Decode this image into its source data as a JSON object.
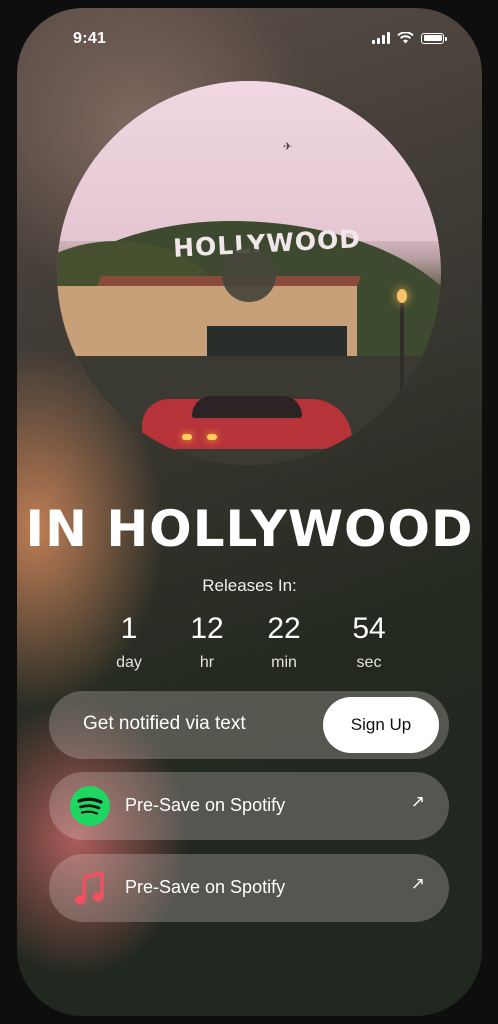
{
  "status_bar": {
    "time": "9:41"
  },
  "album": {
    "sign_text": "HOLLYWOOD"
  },
  "title": "IN HOLLYWOOD",
  "countdown": {
    "label": "Releases In:",
    "units": [
      {
        "value": "1",
        "unit": "day"
      },
      {
        "value": "12",
        "unit": "hr"
      },
      {
        "value": "22",
        "unit": "min"
      },
      {
        "value": "54",
        "unit": "sec"
      }
    ]
  },
  "notify": {
    "label": "Get notified via text",
    "button": "Sign Up"
  },
  "links": [
    {
      "label": "Pre-Save on Spotify",
      "icon": "spotify-icon",
      "arrow": "↗"
    },
    {
      "label": "Pre-Save on Spotify",
      "icon": "apple-music-icon",
      "arrow": "↗"
    }
  ],
  "colors": {
    "spotify": "#1ed760",
    "apple_music": "#f2505e"
  }
}
